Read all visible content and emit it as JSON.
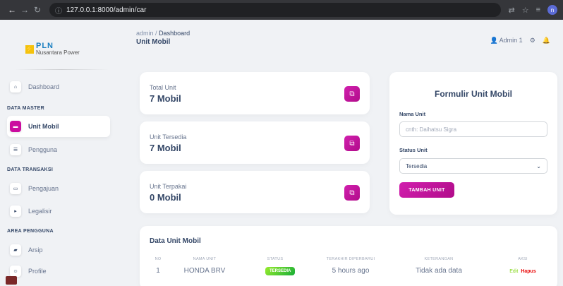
{
  "browser": {
    "url": "127.0.0.1:8000/admin/car",
    "profile_initial": "n"
  },
  "brand": {
    "name": "PLN",
    "tagline": "Nusantara Power"
  },
  "sidebar": {
    "dashboard": "Dashboard",
    "section_master": "DATA MASTER",
    "unit_mobil": "Unit Mobil",
    "pengguna": "Pengguna",
    "section_transaksi": "DATA TRANSAKSI",
    "pengajuan": "Pengajuan",
    "legalisir": "Legalisir",
    "section_pengguna": "AREA PENGGUNA",
    "arsip": "Arsip",
    "profile": "Profile"
  },
  "header": {
    "crumb_root": "admin",
    "crumb_sep": "/",
    "crumb_current": "Dashboard",
    "title": "Unit Mobil",
    "user": "Admin 1"
  },
  "stats": [
    {
      "label": "Total Unit",
      "value": "7 Mobil"
    },
    {
      "label": "Unit Tersedia",
      "value": "7 Mobil"
    },
    {
      "label": "Unit Terpakai",
      "value": "0 Mobil"
    }
  ],
  "form": {
    "title": "Formulir Unit Mobil",
    "name_label": "Nama Unit",
    "name_placeholder": "cnth: Daihatsu Sigra",
    "status_label": "Status Unit",
    "status_value": "Tersedia",
    "submit": "TAMBAH UNIT"
  },
  "table": {
    "title": "Data Unit Mobil",
    "headers": [
      "NO",
      "NAMA UNIT",
      "STATUS",
      "TERAKHIR DIPERBARUI",
      "KETERANGAN",
      "AKSI"
    ],
    "rows": [
      {
        "no": "1",
        "name": "HONDA BRV",
        "status": "TERSEDIA",
        "updated": "5 hours ago",
        "note": "Tidak ada data",
        "edit": "Edit",
        "delete": "Hapus"
      }
    ]
  },
  "colors": {
    "primary": "#cb0c9f",
    "success": "#17ad37",
    "danger": "#ea0606"
  }
}
